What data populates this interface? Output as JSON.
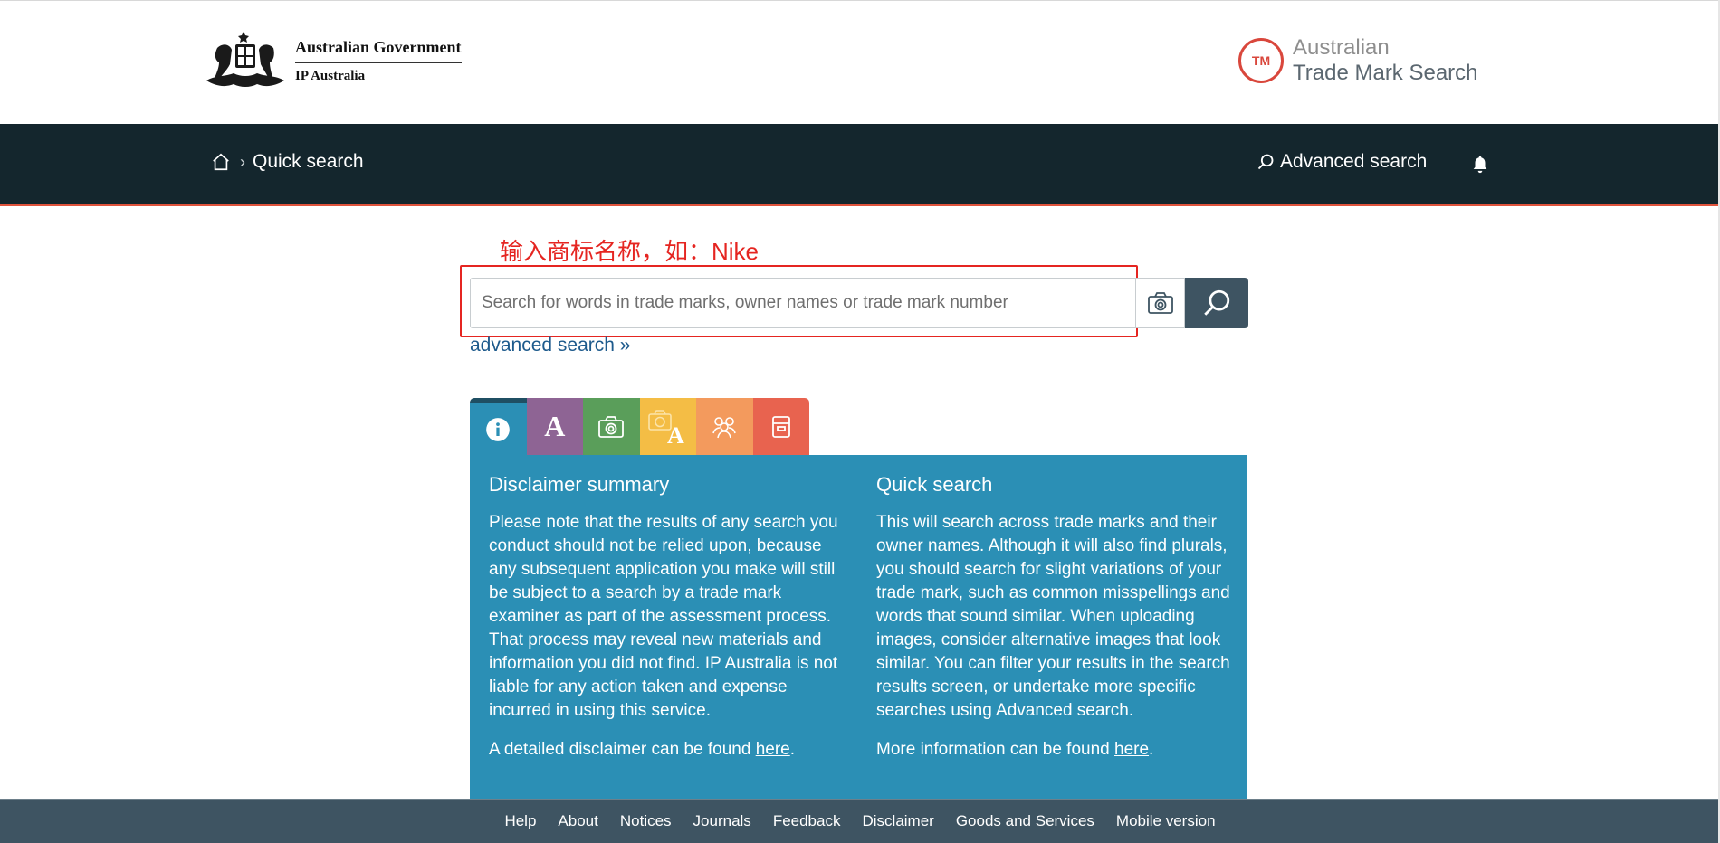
{
  "header": {
    "gov_line1": "Australian Government",
    "gov_line2": "IP Australia",
    "tm_badge": "TM",
    "site_line1": "Australian",
    "site_line2": "Trade Mark Search"
  },
  "nav": {
    "breadcrumb_current": "Quick search",
    "advanced_search": "Advanced search"
  },
  "search": {
    "annotation": "输入商标名称，如：Nike",
    "placeholder": "Search for words in trade marks, owner names or trade mark number",
    "value": "",
    "advanced_link": "advanced search »"
  },
  "tabs": [
    {
      "name": "info",
      "icon": "info-icon"
    },
    {
      "name": "word",
      "icon": "letter-a-icon",
      "glyph": "A"
    },
    {
      "name": "image",
      "icon": "camera-icon"
    },
    {
      "name": "word-and-image",
      "icon": "camera-letter-icon",
      "glyph": "A"
    },
    {
      "name": "owner",
      "icon": "people-icon"
    },
    {
      "name": "number",
      "icon": "document-icon"
    }
  ],
  "panel": {
    "left": {
      "title": "Disclaimer summary",
      "body": "Please note that the results of any search you conduct should not be relied upon, because any subsequent application you make will still be subject to a search by a trade mark examiner as part of the assessment process. That process may reveal new materials and information you did not find. IP Australia is not liable for any action taken and expense incurred in using this service.",
      "more_prefix": "A detailed disclaimer can be found ",
      "more_link": "here",
      "more_suffix": "."
    },
    "right": {
      "title": "Quick search",
      "body": "This will search across trade marks and their owner names. Although it will also find plurals, you should search for slight variations of your trade mark, such as common misspellings and words that sound similar. When uploading images, consider alternative images that look similar. You can filter your results in the search results screen, or undertake more specific searches using Advanced search.",
      "more_prefix": "More information can be found ",
      "more_link": "here",
      "more_suffix": "."
    }
  },
  "footer": {
    "links": [
      "Help",
      "About",
      "Notices",
      "Journals",
      "Feedback",
      "Disclaimer",
      "Goods and Services",
      "Mobile version"
    ]
  },
  "colors": {
    "nav_bg": "#14262d",
    "accent_red": "#e0533c",
    "panel_blue": "#2b8fb5",
    "footer_bg": "#3e5462",
    "annotation_red": "#e52521"
  }
}
